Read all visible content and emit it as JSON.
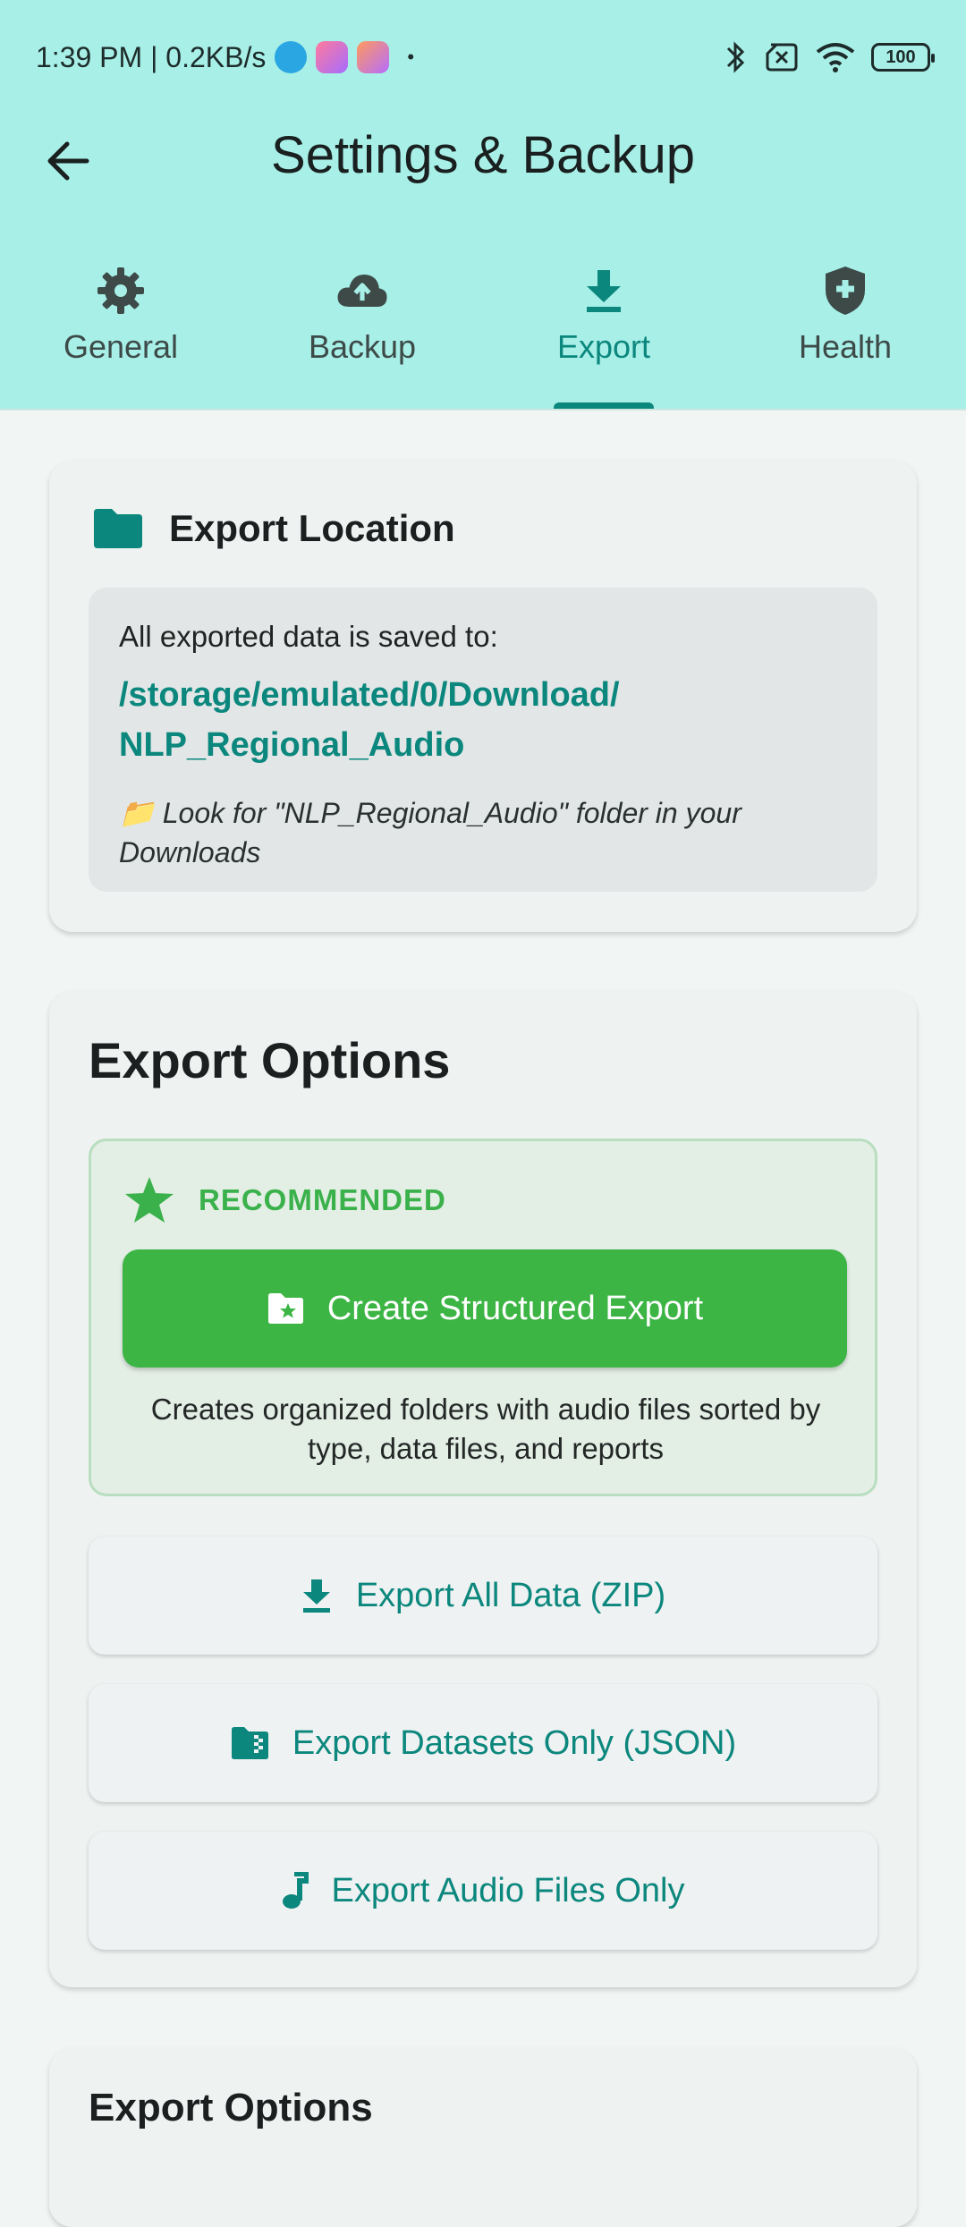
{
  "status_bar": {
    "time_speed": "1:39 PM | 0.2KB/s",
    "dot": "•",
    "battery": "100"
  },
  "app_bar": {
    "title": "Settings & Backup"
  },
  "tabs": [
    {
      "label": "General",
      "icon": "gear-icon"
    },
    {
      "label": "Backup",
      "icon": "cloud-upload-icon"
    },
    {
      "label": "Export",
      "icon": "download-icon",
      "active": true
    },
    {
      "label": "Health",
      "icon": "shield-plus-icon"
    }
  ],
  "export_location": {
    "title": "Export Location",
    "label": "All exported data is saved to:",
    "path_line1": "/storage/emulated/0/Download/",
    "path_line2": "NLP_Regional_Audio",
    "hint_line1": "📁 Look for \"NLP_Regional_Audio\" folder in your",
    "hint_line2": "Downloads"
  },
  "export_options": {
    "title": "Export Options",
    "recommended_label": "RECOMMENDED",
    "primary_button": "Create Structured Export",
    "primary_desc_line1": "Creates organized folders with audio files sorted by",
    "primary_desc_line2": "type, data files, and reports",
    "buttons": [
      {
        "label": "Export All Data (ZIP)",
        "icon": "download-icon"
      },
      {
        "label": "Export Datasets Only (JSON)",
        "icon": "folder-zip-icon"
      },
      {
        "label": "Export Audio Files Only",
        "icon": "music-note-icon"
      }
    ]
  },
  "second_section": {
    "title": "Export Options"
  },
  "colors": {
    "header_bg": "#a7efe7",
    "accent": "#0b877d",
    "green": "#3cb544"
  }
}
